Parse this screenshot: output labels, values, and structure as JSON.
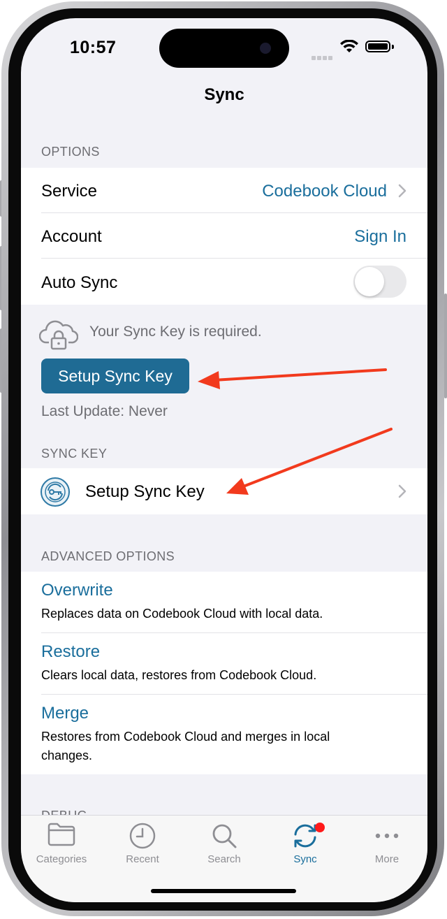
{
  "status_bar": {
    "time": "10:57"
  },
  "nav": {
    "title": "Sync"
  },
  "options": {
    "header": "OPTIONS",
    "service": {
      "label": "Service",
      "value": "Codebook Cloud"
    },
    "account": {
      "label": "Account",
      "value": "Sign In"
    },
    "auto_sync": {
      "label": "Auto Sync",
      "enabled": false
    }
  },
  "sync_notice": {
    "message": "Your Sync Key is required.",
    "button": "Setup Sync Key",
    "last_update": "Last Update: Never"
  },
  "sync_key": {
    "header": "SYNC KEY",
    "row_label": "Setup Sync Key"
  },
  "advanced": {
    "header": "ADVANCED OPTIONS",
    "items": [
      {
        "title": "Overwrite",
        "description": "Replaces data on Codebook Cloud with local data."
      },
      {
        "title": "Restore",
        "description": "Clears local data, restores from Codebook Cloud."
      },
      {
        "title": "Merge",
        "description": "Restores from Codebook Cloud and merges in local changes."
      }
    ]
  },
  "debug": {
    "header": "DEBUG"
  },
  "tabbar": {
    "tabs": [
      {
        "label": "Categories",
        "icon": "folder-icon"
      },
      {
        "label": "Recent",
        "icon": "clock-icon"
      },
      {
        "label": "Search",
        "icon": "magnifier-icon"
      },
      {
        "label": "Sync",
        "icon": "sync-icon",
        "active": true,
        "badge": true
      },
      {
        "label": "More",
        "icon": "ellipsis-icon"
      }
    ]
  },
  "colors": {
    "accent": "#1a6e9c",
    "button": "#1f6b94",
    "annotation_arrow": "#f23a1d",
    "badge": "#ff1a1a"
  }
}
